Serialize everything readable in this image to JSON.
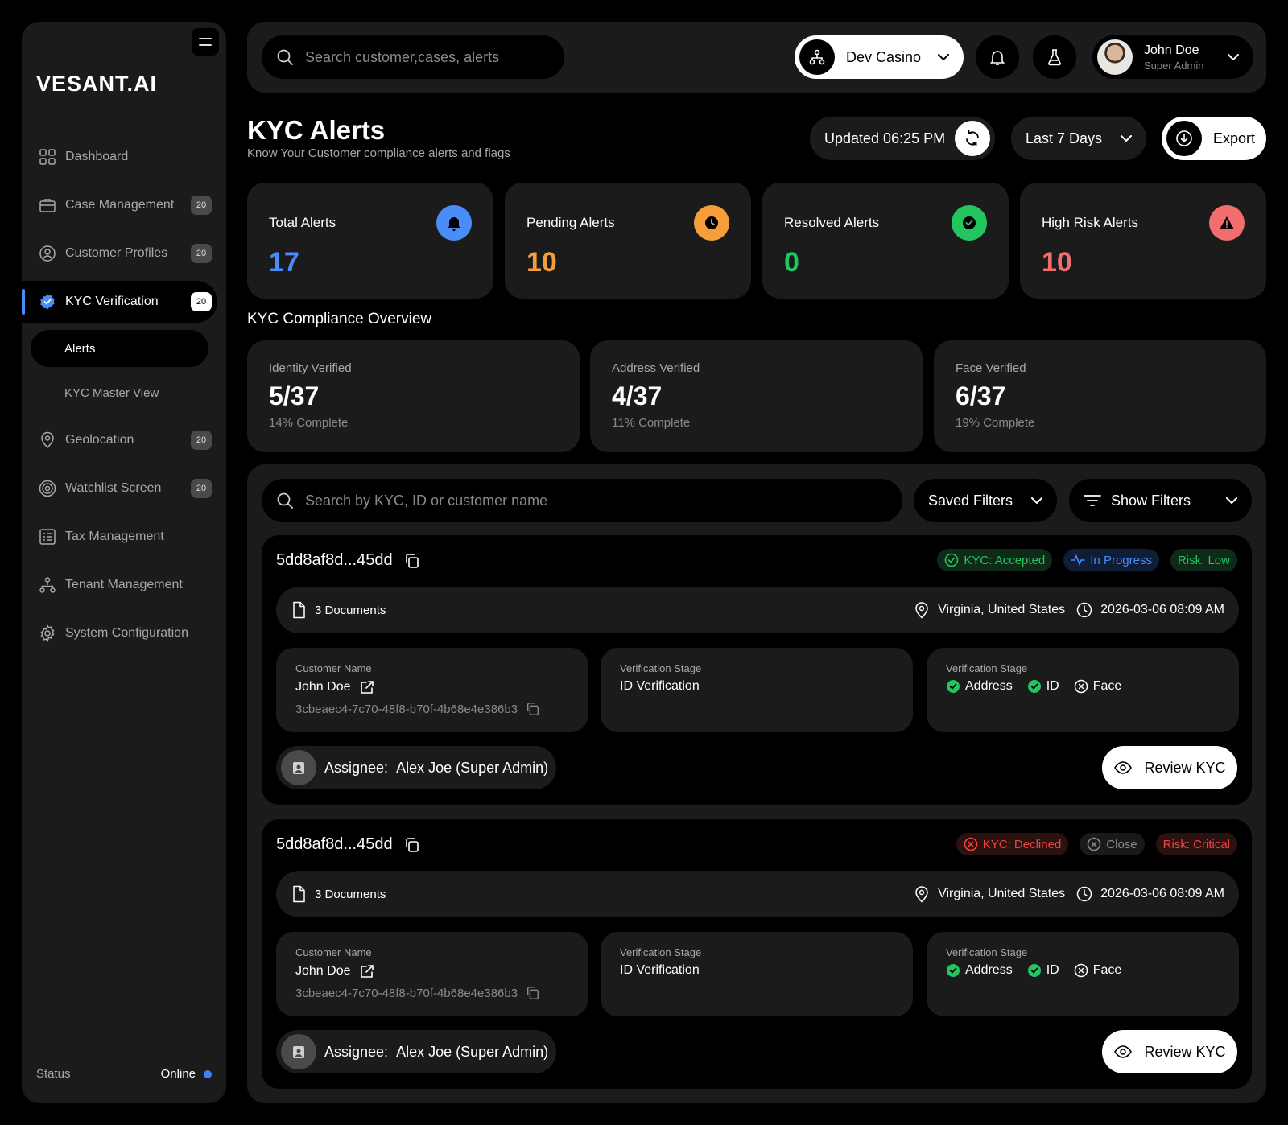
{
  "app": {
    "logo": "VESANT.AI"
  },
  "sidebar": {
    "items": [
      {
        "label": "Dashboard",
        "icon": "grid-icon"
      },
      {
        "label": "Case Management",
        "icon": "briefcase-icon",
        "badge": "20"
      },
      {
        "label": "Customer Profiles",
        "icon": "user-circle-icon",
        "badge": "20"
      },
      {
        "label": "KYC Verification",
        "icon": "verified-badge-icon",
        "badge": "20",
        "active": true
      },
      {
        "label": "Geolocation",
        "icon": "location-pin-icon",
        "badge": "20"
      },
      {
        "label": "Watchlist Screen",
        "icon": "target-icon",
        "badge": "20"
      },
      {
        "label": "Tax Management",
        "icon": "receipt-icon"
      },
      {
        "label": "Tenant Management",
        "icon": "hierarchy-icon"
      },
      {
        "label": "System Configuration",
        "icon": "gear-icon"
      }
    ],
    "sub_items": [
      {
        "label": "Alerts",
        "active": true
      },
      {
        "label": "KYC Master View"
      }
    ],
    "status_label": "Status",
    "status_value": "Online"
  },
  "topbar": {
    "search_placeholder": "Search customer,cases, alerts",
    "tenant": "Dev Casino",
    "user_name": "John Doe",
    "user_role": "Super Admin"
  },
  "header": {
    "title": "KYC Alerts",
    "subtitle": "Know Your Customer compliance alerts and flags",
    "updated": "Updated 06:25 PM",
    "range": "Last 7 Days",
    "export": "Export"
  },
  "stats": [
    {
      "label": "Total Alerts",
      "value": "17",
      "color": "#4b8df8"
    },
    {
      "label": "Pending Alerts",
      "value": "10",
      "color": "#f59e3b"
    },
    {
      "label": "Resolved Alerts",
      "value": "0",
      "color": "#22c55e"
    },
    {
      "label": "High Risk Alerts",
      "value": "10",
      "color": "#f26d6d"
    }
  ],
  "overview": {
    "title": "KYC Compliance Overview",
    "cards": [
      {
        "label": "Identity Verified",
        "value": "5/37",
        "sub": "14% Complete"
      },
      {
        "label": "Address Verified",
        "value": "4/37",
        "sub": "11% Complete"
      },
      {
        "label": "Face Verified",
        "value": "6/37",
        "sub": "19% Complete"
      }
    ]
  },
  "list": {
    "search_placeholder": "Search by KYC, ID or customer name",
    "saved_filters": "Saved Filters",
    "show_filters": "Show Filters",
    "alerts": [
      {
        "id": "5dd8af8d...45dd",
        "tags": [
          "KYC: Accepted",
          "In Progress",
          "Risk: Low"
        ],
        "documents": "3 Documents",
        "location": "Virginia, United States",
        "timestamp": "2026-03-06 08:09 AM",
        "customer_label": "Customer Name",
        "customer_name": "John Doe",
        "customer_id": "3cbeaec4-7c70-48f8-b70f-4b68e4e386b3",
        "stage_label": "Verification Stage",
        "stage_value": "ID Verification",
        "stages_label": "Verification Stage",
        "stages": [
          "Address",
          "ID",
          "Face"
        ],
        "assignee_label": "Assignee:",
        "assignee": "Alex Joe (Super Admin)",
        "review": "Review KYC"
      },
      {
        "id": "5dd8af8d...45dd",
        "tags": [
          "KYC: Declined",
          "Close",
          "Risk: Critical"
        ],
        "documents": "3 Documents",
        "location": "Virginia, United States",
        "timestamp": "2026-03-06 08:09 AM",
        "customer_label": "Customer Name",
        "customer_name": "John Doe",
        "customer_id": "3cbeaec4-7c70-48f8-b70f-4b68e4e386b3",
        "stage_label": "Verification Stage",
        "stage_value": "ID Verification",
        "stages_label": "Verification Stage",
        "stages": [
          "Address",
          "ID",
          "Face"
        ],
        "assignee_label": "Assignee:",
        "assignee": "Alex Joe (Super Admin)",
        "review": "Review KYC"
      }
    ]
  }
}
